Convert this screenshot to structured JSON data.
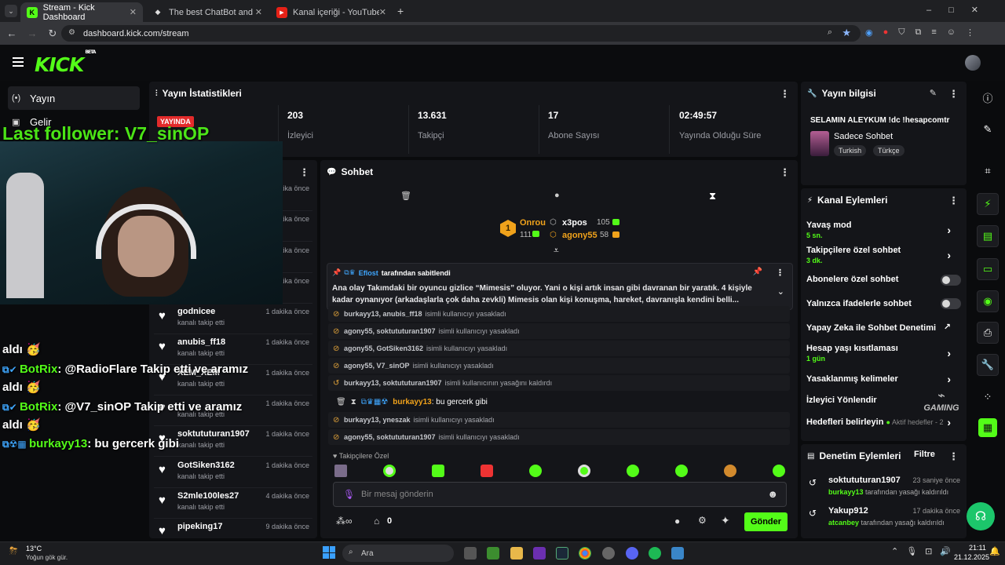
{
  "browser": {
    "tabs": [
      {
        "title": "Stream - Kick Dashboard",
        "active": true
      },
      {
        "title": "The best ChatBot and Widgets",
        "active": false
      },
      {
        "title": "Kanal içeriği - YouTube Studio",
        "active": false
      }
    ],
    "url": "dashboard.kick.com/stream"
  },
  "header": {
    "logo": "KICK",
    "logo_badge": "BETA"
  },
  "nav": {
    "items": [
      {
        "label": "Yayın",
        "icon": "broadcast-icon"
      },
      {
        "label": "Gelir",
        "icon": "revenue-icon"
      }
    ]
  },
  "stats": {
    "title": "Yayın İstatistikleri",
    "live_badge": "YAYINDA",
    "items": [
      {
        "value": "203",
        "label": "İzleyici"
      },
      {
        "value": "13.631",
        "label": "Takipçi"
      },
      {
        "value": "17",
        "label": "Abone Sayısı"
      },
      {
        "value": "02:49:57",
        "label": "Yayında Olduğu Süre"
      }
    ]
  },
  "stream_overlay": {
    "last_follower": "Last follower: V7_sinOP",
    "lines": [
      {
        "user": "",
        "text": "aldı 🥳"
      },
      {
        "user": "BotRix",
        "text": ": @RadioFlare Takip etti ve aramız"
      },
      {
        "user": "",
        "text": "aldı 🥳"
      },
      {
        "user": "BotRix",
        "text": ": @V7_sinOP Takip etti ve aramız"
      },
      {
        "user": "",
        "text": "aldı 🥳"
      },
      {
        "user": "burkayy13",
        "text": ": bu gercerk gibi"
      }
    ]
  },
  "followers": {
    "rows": [
      {
        "name": "",
        "sub": "",
        "time": "1 dakika önce"
      },
      {
        "name": "",
        "sub": "",
        "time": "1 dakika önce"
      },
      {
        "name": "",
        "sub": "",
        "time": "1 dakika önce"
      },
      {
        "name": "",
        "sub": "",
        "time": "1 dakika önce"
      },
      {
        "name": "godnicee",
        "sub": "kanalı takip etti",
        "time": "1 dakika önce"
      },
      {
        "name": "anubis_ff18",
        "sub": "kanalı takip etti",
        "time": "1 dakika önce"
      },
      {
        "name": "XEM_XEM",
        "sub": "kanalı takip etti",
        "time": "1 dakika önce"
      },
      {
        "name": "",
        "sub": "kanalı takip etti",
        "time": "1 dakika önce"
      },
      {
        "name": "soktututuran1907",
        "sub": "kanalı takip etti",
        "time": "1 dakika önce"
      },
      {
        "name": "GotSiken3162",
        "sub": "kanalı takip etti",
        "time": "1 dakika önce"
      },
      {
        "name": "S2mle100les27",
        "sub": "kanalı takip etti",
        "time": "4 dakika önce"
      },
      {
        "name": "pipeking17",
        "sub": "kanalı takip etti",
        "time": "9 dakika önce"
      }
    ]
  },
  "chat": {
    "title": "Sohbet",
    "leaderboard": [
      {
        "rank": "1",
        "name": "Onrou",
        "count": "111"
      },
      {
        "name": "x3pos",
        "count": "105"
      },
      {
        "name": "agony55",
        "count": "58"
      }
    ],
    "pinned": {
      "author": "Eflost",
      "header_suffix": "tarafından sabitlendi",
      "text": "Ana olay Takımdaki bir oyuncu gizlice “Mimesis” oluyor. Yani o kişi artık insan gibi davranan bir yaratık. 4 kişiyle kadar oynanıyor (arkadaşlarla çok daha zevkli) Mimesis olan kişi konuşma, hareket, davranışla kendini belli..."
    },
    "events": [
      {
        "users": "burkayy13, anubis_ff18",
        "text": "isimli kullanıcıyı yasakladı"
      },
      {
        "users": "agony55, soktututuran1907",
        "text": "isimli kullanıcıyı yasakladı"
      },
      {
        "users": "agony55, GotSiken3162",
        "text": "isimli kullanıcıyı yasakladı"
      },
      {
        "users": "agony55, V7_sinOP",
        "text": "isimli kullanıcıyı yasakladı"
      },
      {
        "users": "burkayy13, soktututuran1907",
        "text": "isimli kullanıcının yasağını kaldırdı"
      },
      {
        "users": "burkayy13, yneszak",
        "text": "isimli kullanıcıyı yasakladı"
      },
      {
        "users": "agony55, soktututuran1907",
        "text": "isimli kullanıcıyı yasakladı"
      }
    ],
    "message": {
      "user": "burkayy13",
      "text": ": bu gercerk gibi"
    },
    "emote_section": "Takipçilere Özel",
    "input_placeholder": "Bir mesaj gönderin",
    "points": "0",
    "send_label": "Gönder"
  },
  "stream_info": {
    "title": "Yayın bilgisi",
    "stream_title": "SELAMIN ALEYKÜM !dc !hesapcomtr",
    "category": "Sadece Sohbet",
    "tags": [
      "Turkish",
      "Türkçe"
    ]
  },
  "channel_actions": {
    "title": "Kanal Eylemleri",
    "items": [
      {
        "label": "Yavaş mod",
        "sub": "5 sn."
      },
      {
        "label": "Takipçilere özel sohbet",
        "sub": "3 dk."
      },
      {
        "label": "Abonelere özel sohbet",
        "sub": ""
      },
      {
        "label": "Yalnızca ifadelerle sohbet",
        "sub": ""
      },
      {
        "label": "Yapay Zeka ile Sohbet Denetimi",
        "sub": ""
      },
      {
        "label": "Hesap yaşı kısıtlaması",
        "sub": "1 gün"
      },
      {
        "label": "Yasaklanmış kelimeler",
        "sub": ""
      },
      {
        "label": "İzleyici Yönlendir",
        "sub": ""
      },
      {
        "label": "Hedefleri belirleyin",
        "sub": "Aktif hedefler - 2"
      }
    ],
    "watermark": "GAMING"
  },
  "mod_actions": {
    "title": "Denetim Eylemleri",
    "filter": "Filtre",
    "items": [
      {
        "user": "soktututuran1907",
        "time": "23 saniye önce",
        "actor": "burkayy13",
        "text": "tarafından yasağı kaldırıldı"
      },
      {
        "user": "Yakup912",
        "time": "17 dakika önce",
        "actor": "atcanbey",
        "text": "tarafından yasağı kaldırıldı"
      }
    ]
  },
  "taskbar": {
    "weather_temp": "13°C",
    "weather_desc": "Yoğun gök gür.",
    "search": "Ara",
    "time": "21:11",
    "date": "21.12.2025"
  },
  "colors": {
    "accent": "#53fc18",
    "live": "#e32b2b",
    "panel": "#141519"
  }
}
